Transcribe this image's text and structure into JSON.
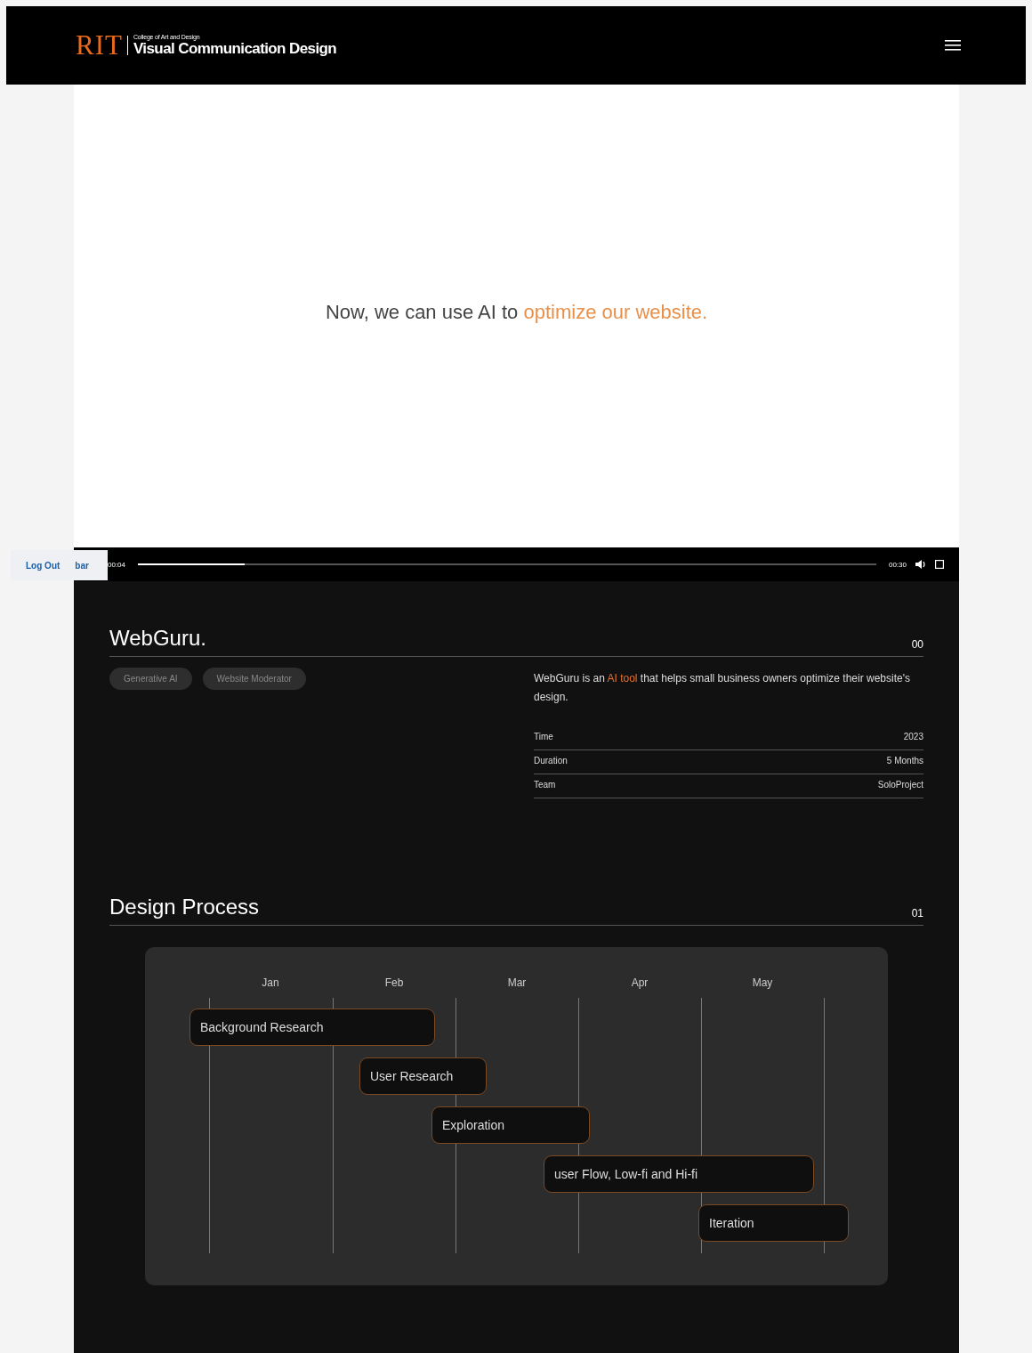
{
  "header": {
    "logo": "RIT",
    "college": "College of Art and Design",
    "department": "Visual Communication Design"
  },
  "hero": {
    "text": "Now, we can use AI to",
    "highlight": "optimize our website."
  },
  "overlay_links": [
    {
      "label": "Log Out"
    },
    {
      "label": "bar"
    }
  ],
  "video": {
    "current_time": "00:04",
    "total_time": "00:30",
    "level": 0.144
  },
  "project": {
    "title": "WebGuru.",
    "number": "00",
    "tags": [
      "Generative AI",
      "Website Moderator"
    ],
    "description": "WebGuru is an **AI tool** that helps small business owners optimize their website's design.",
    "facts": [
      {
        "label": "Time",
        "value": "2023"
      },
      {
        "label": "Duration",
        "value": "5 Months"
      },
      {
        "label": "Team",
        "value": "SoloProject"
      }
    ]
  },
  "process": {
    "title": "Design Process",
    "number": "01",
    "months": [
      "Jan",
      "Feb",
      "Mar",
      "Apr",
      "May"
    ],
    "tasks": [
      {
        "label": "Background Research"
      },
      {
        "label": "User Research"
      },
      {
        "label": "Exploration"
      },
      {
        "label": "user Flow, Low-fi and Hi-fi"
      },
      {
        "label": "Iteration"
      }
    ]
  }
}
